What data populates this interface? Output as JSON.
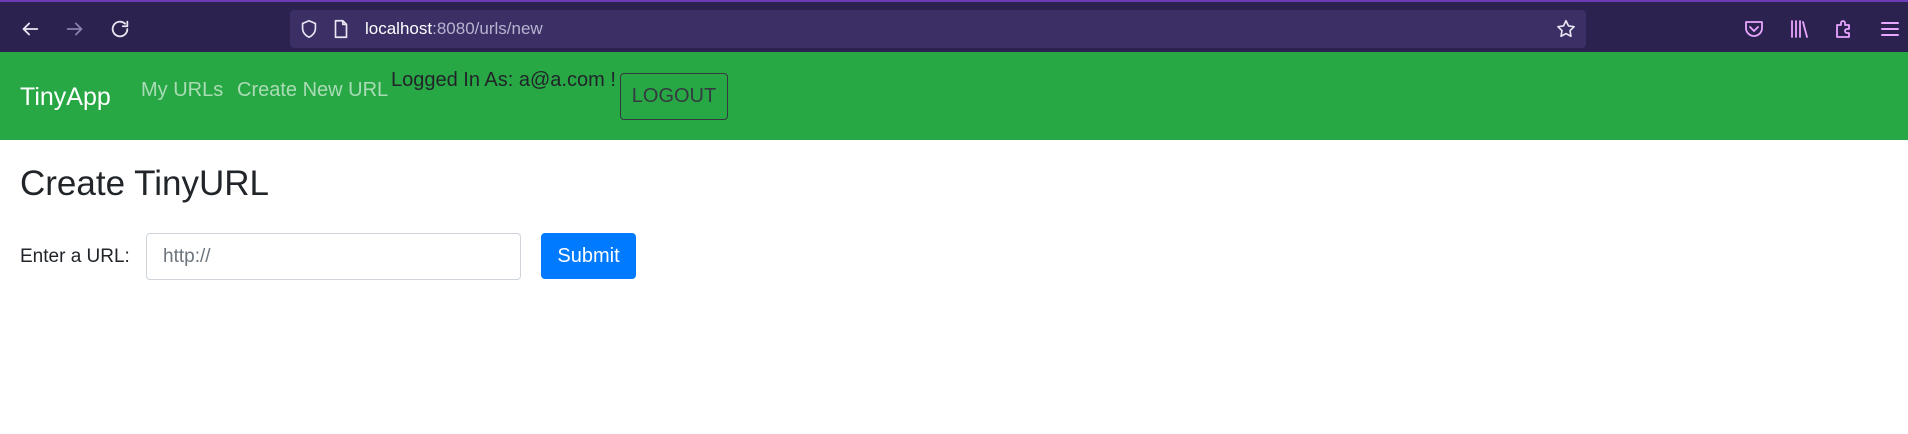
{
  "browser": {
    "url_host": "localhost",
    "url_path": ":8080/urls/new",
    "icons": {
      "back": "arrow-left-icon",
      "forward": "arrow-right-icon",
      "reload": "reload-icon",
      "shield": "shield-icon",
      "page": "page-icon",
      "bookmark": "star-icon",
      "pocket": "pocket-icon",
      "library": "library-icon",
      "extensions": "puzzle-icon",
      "menu": "hamburger-menu-icon"
    },
    "colors": {
      "chrome": "#2b2250",
      "urlbar": "#3b2f66"
    }
  },
  "navbar": {
    "brand": "TinyApp",
    "links": [
      {
        "label": "My URLs"
      },
      {
        "label": "Create New URL"
      }
    ],
    "logged_in_text": "Logged In As: a@a.com !",
    "logout_label": "LOGOUT",
    "colors": {
      "background": "#28a745"
    }
  },
  "main": {
    "title": "Create TinyURL",
    "form": {
      "label": "Enter a URL:",
      "input_value": "",
      "input_placeholder": "http://",
      "submit_label": "Submit"
    },
    "colors": {
      "primary": "#007bff"
    }
  }
}
